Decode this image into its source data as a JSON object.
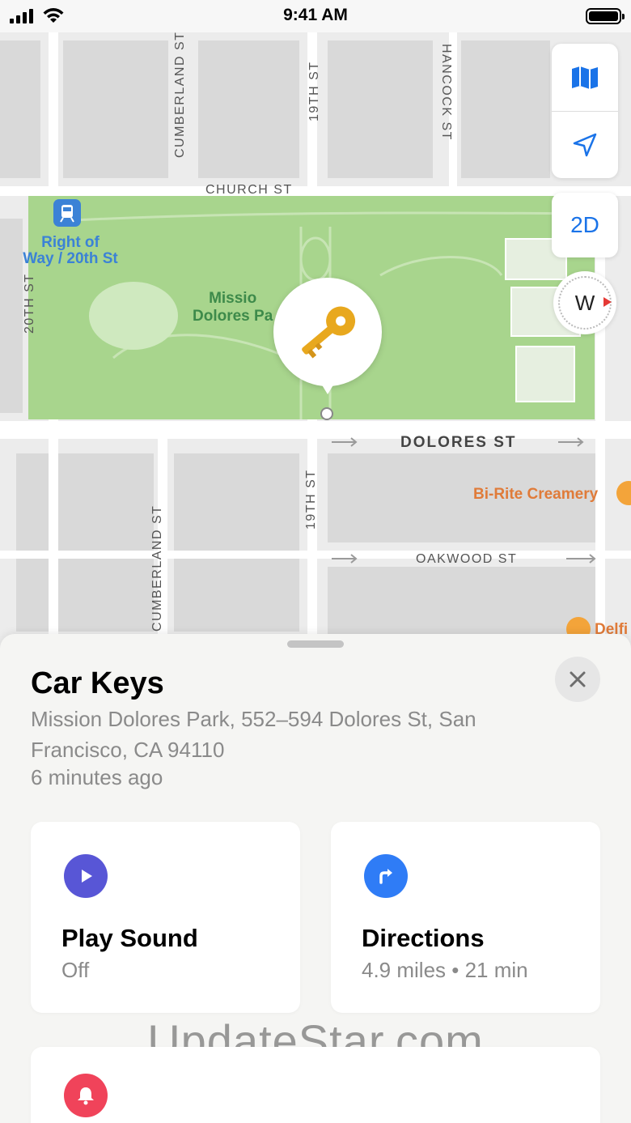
{
  "status_bar": {
    "time": "9:41 AM"
  },
  "map": {
    "streets": {
      "cumberland_top": "CUMBERLAND ST",
      "nineteenth_top": "19TH ST",
      "hancock": "HANCOCK ST",
      "church": "CHURCH ST",
      "twentieth": "20TH ST",
      "dolores": "DOLORES ST",
      "nineteenth_bottom": "19TH ST",
      "cumberland_bottom": "CUMBERLAND ST",
      "oakwood": "OAKWOOD ST"
    },
    "transit_line1": "Right of",
    "transit_line2": "Way / 20th St",
    "park_line1": "Missio",
    "park_line2": "Dolores Pa",
    "creamery": "Bi-Rite Creamery",
    "delfi": "Delfi",
    "control_2d": "2D",
    "compass_label": "W"
  },
  "sheet": {
    "title": "Car Keys",
    "address": "Mission Dolores Park, 552–594 Dolores St, San Francisco, CA  94110",
    "time_ago": "6 minutes ago",
    "play_sound": {
      "title": "Play Sound",
      "sub": "Off"
    },
    "directions": {
      "title": "Directions",
      "sub": "4.9 miles • 21 min"
    },
    "watermark": "UpdateStar.com"
  },
  "colors": {
    "accent": "#1a73e8",
    "play_icon": "#5856d6",
    "directions_icon": "#2f7cf6",
    "notify_icon": "#f0435a",
    "park_green": "#a8d58d"
  }
}
